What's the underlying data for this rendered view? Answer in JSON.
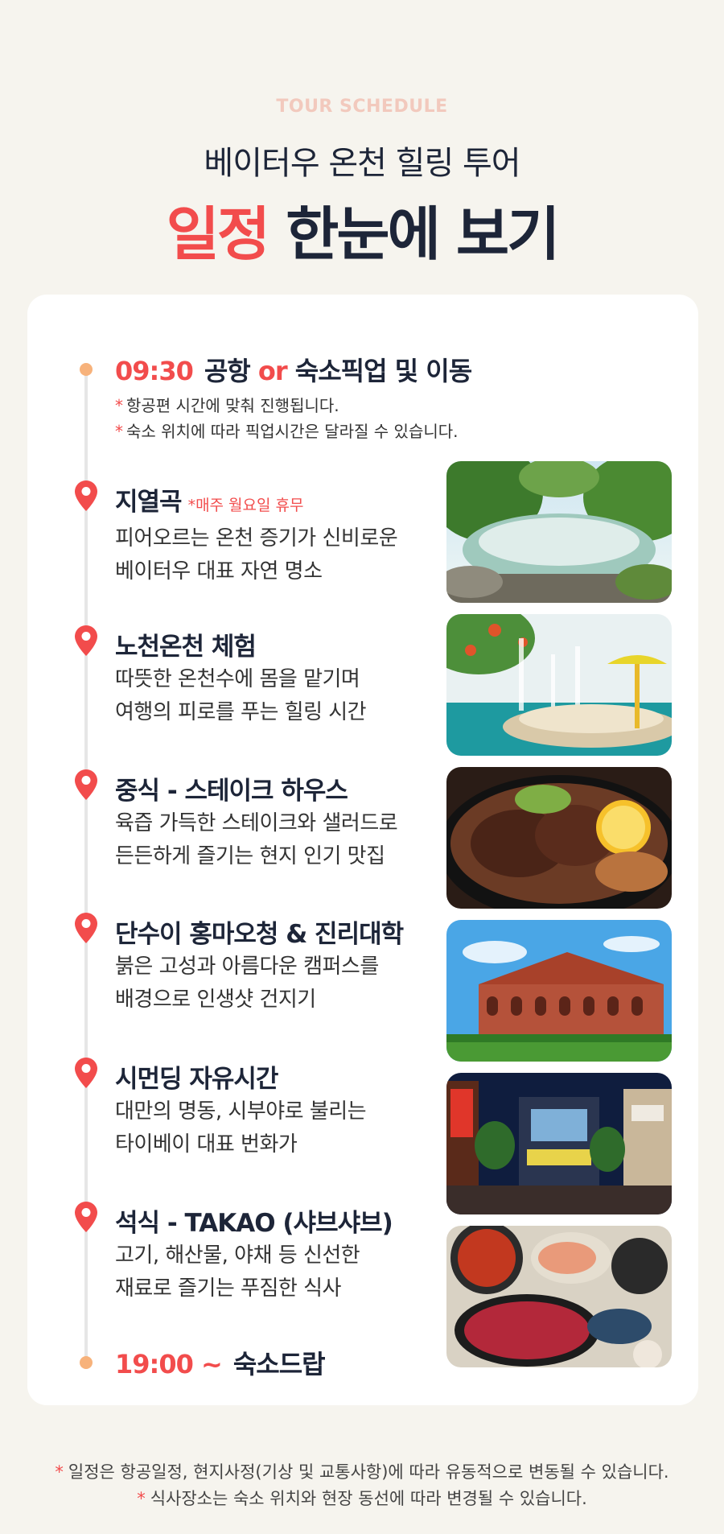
{
  "header": {
    "eyebrow": "TOUR SCHEDULE",
    "subtitle": "베이터우 온천 힐링 투어",
    "title_accent": "일정",
    "title_rest": "한눈에 보기"
  },
  "start": {
    "time": "09:30",
    "label_part1": "공항",
    "label_or": "or",
    "label_part2": "숙소픽업 및 이동",
    "notes": [
      "항공편 시간에 맞춰 진행됩니다.",
      "숙소 위치에 따라 픽업시간은 달라질 수 있습니다."
    ]
  },
  "stops": [
    {
      "title": "지열곡",
      "badge": "*매주 월요일 휴무",
      "desc1": "피어오르는 온천 증기가 신비로운",
      "desc2": "베이터우 대표 자연 명소",
      "photo": "geothermal-valley-photo"
    },
    {
      "title": "노천온천 체험",
      "badge": "",
      "desc1": "따뜻한 온천수에 몸을 맡기며",
      "desc2": "여행의 피로를 푸는 힐링 시간",
      "photo": "outdoor-hot-spring-photo"
    },
    {
      "title": "중식 - 스테이크 하우스",
      "badge": "",
      "desc1": "육즙 가득한 스테이크와 샐러드로",
      "desc2": "든든하게 즐기는 현지 인기 맛집",
      "photo": "steak-plate-photo"
    },
    {
      "title": "단수이 홍마오청 & 진리대학",
      "badge": "",
      "desc1": "붉은 고성과 아름다운 캠퍼스를",
      "desc2": "배경으로 인생샷 건지기",
      "photo": "red-fort-photo"
    },
    {
      "title": "시먼딩 자유시간",
      "badge": "",
      "desc1": "대만의 명동, 시부야로 불리는",
      "desc2": "타이베이 대표 번화가",
      "photo": "ximending-night-photo"
    },
    {
      "title": "석식 - TAKAO (샤브샤브)",
      "badge": "",
      "desc1": "고기, 해산물, 야채 등 신선한",
      "desc2": "재료로 즐기는 푸짐한 식사",
      "photo": "shabu-shabu-photo"
    }
  ],
  "end": {
    "time": "19:00 ~",
    "label": "숙소드랍"
  },
  "footer": {
    "notes": [
      "일정은 항공일정, 현지사정(기상 및 교통사항)에 따라 유동적으로 변동될 수 있습니다.",
      "식사장소는 숙소 위치와 현장 동선에 따라  변경될 수 있습니다."
    ]
  },
  "colors": {
    "accent": "#f24c4c",
    "navy": "#1d2538",
    "background": "#f6f4ee",
    "dot": "#f7b27b"
  }
}
